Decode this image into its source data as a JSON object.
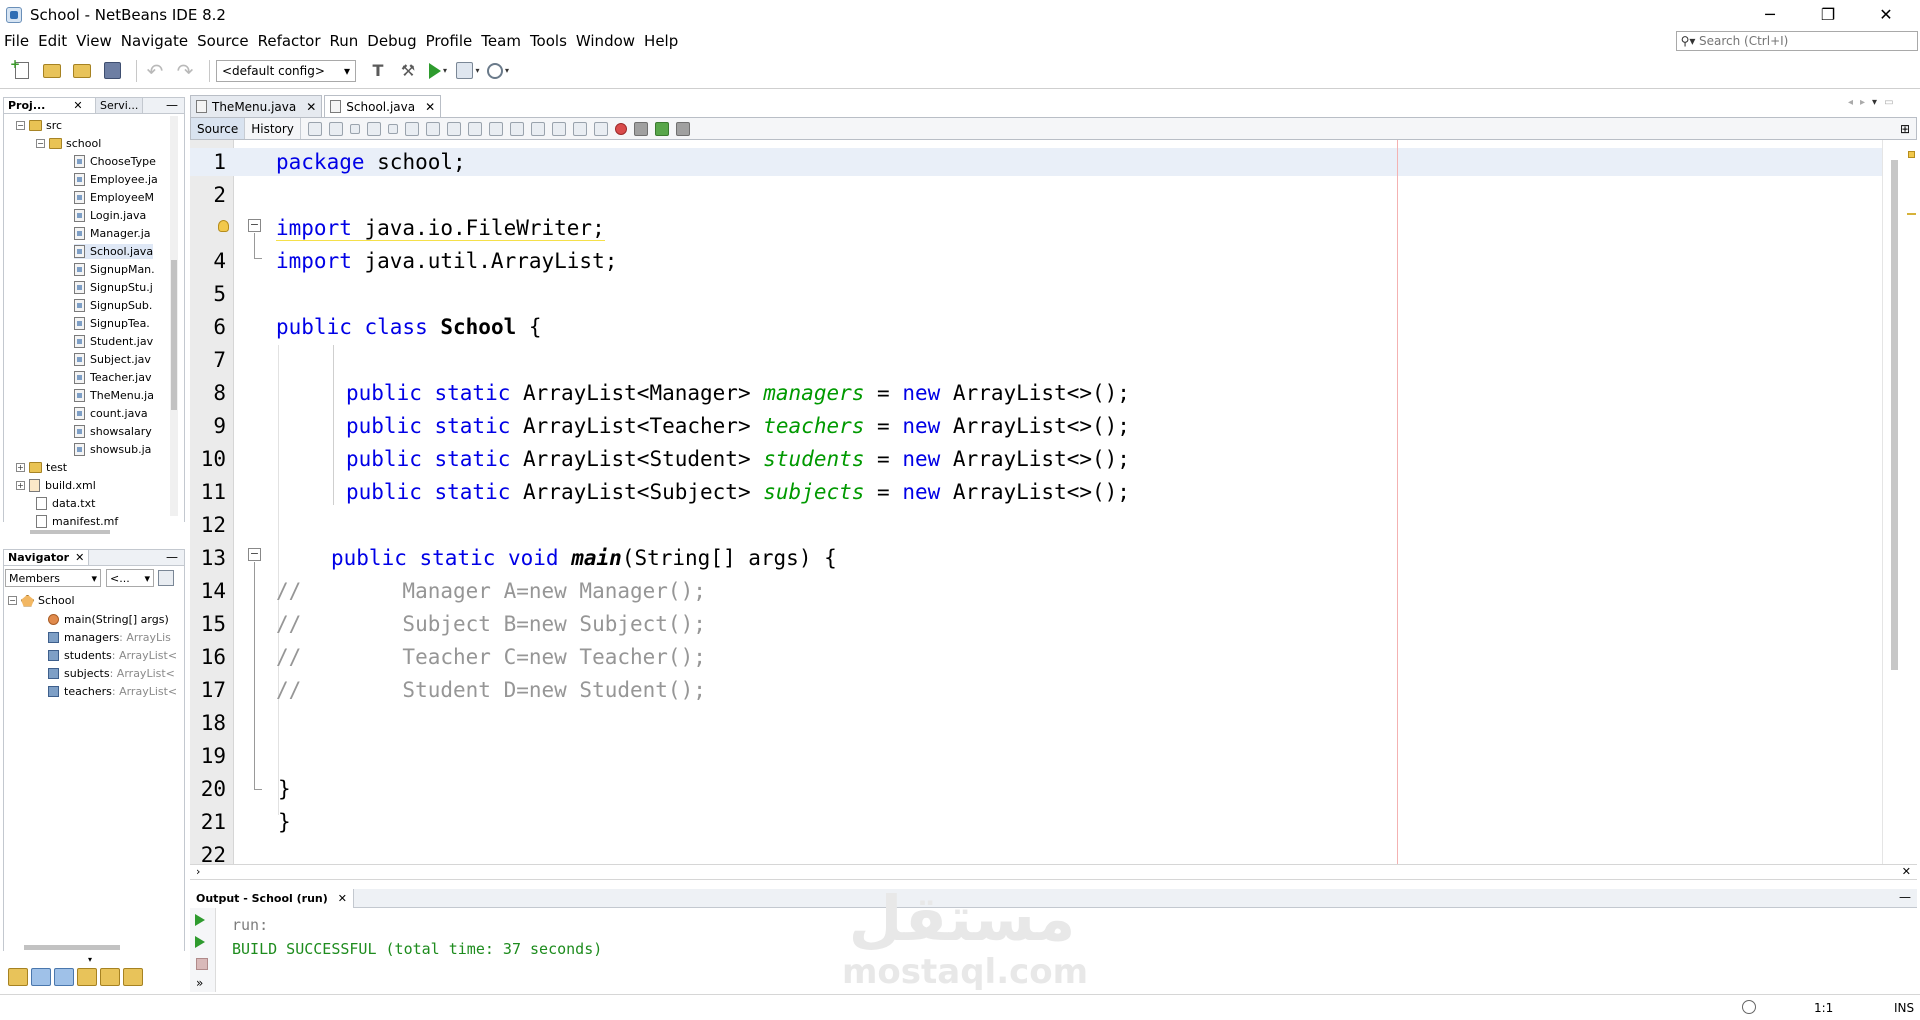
{
  "window": {
    "title": "School - NetBeans IDE 8.2",
    "minimize": "─",
    "maximize": "❐",
    "close": "✕"
  },
  "menu": [
    "File",
    "Edit",
    "View",
    "Navigate",
    "Source",
    "Refactor",
    "Run",
    "Debug",
    "Profile",
    "Team",
    "Tools",
    "Window",
    "Help"
  ],
  "search": {
    "placeholder": "Search (Ctrl+I)"
  },
  "toolbar": {
    "config": "<default config>"
  },
  "projects_panel": {
    "tabs": [
      "Proj...",
      "Servi..."
    ],
    "tree": [
      {
        "label": "src",
        "kind": "folder"
      },
      {
        "label": "school",
        "kind": "package"
      },
      {
        "label": "ChooseType",
        "kind": "java"
      },
      {
        "label": "Employee.ja",
        "kind": "java"
      },
      {
        "label": "EmployeeM",
        "kind": "java"
      },
      {
        "label": "Login.java",
        "kind": "java"
      },
      {
        "label": "Manager.ja",
        "kind": "java"
      },
      {
        "label": "School.java",
        "kind": "java"
      },
      {
        "label": "SignupMan.",
        "kind": "java"
      },
      {
        "label": "SignupStu.j",
        "kind": "java"
      },
      {
        "label": "SignupSub.",
        "kind": "java"
      },
      {
        "label": "SignupTea.",
        "kind": "java"
      },
      {
        "label": "Student.jav",
        "kind": "java"
      },
      {
        "label": "Subject.jav",
        "kind": "java"
      },
      {
        "label": "Teacher.jav",
        "kind": "java"
      },
      {
        "label": "TheMenu.ja",
        "kind": "java"
      },
      {
        "label": "count.java",
        "kind": "java"
      },
      {
        "label": "showsalary",
        "kind": "java"
      },
      {
        "label": "showsub.ja",
        "kind": "java"
      },
      {
        "label": "test",
        "kind": "folder"
      },
      {
        "label": "build.xml",
        "kind": "xml"
      },
      {
        "label": "data.txt",
        "kind": "txt"
      },
      {
        "label": "manifest.mf",
        "kind": "txt"
      }
    ]
  },
  "navigator": {
    "tab": "Navigator",
    "filter": "Members",
    "filter2": "<...",
    "root": "School",
    "members": [
      {
        "name": "main",
        "type": "(String[] args)",
        "kind": "method"
      },
      {
        "name": "managers",
        "type": " : ArrayLis",
        "kind": "field"
      },
      {
        "name": "students",
        "type": " : ArrayList<",
        "kind": "field"
      },
      {
        "name": "subjects",
        "type": " : ArrayList<",
        "kind": "field"
      },
      {
        "name": "teachers",
        "type": " : ArrayList<",
        "kind": "field"
      }
    ]
  },
  "editor": {
    "tabs": [
      "TheMenu.java",
      "School.java"
    ],
    "active_tab": "School.java",
    "view_tabs": [
      "Source",
      "History"
    ],
    "line_numbers": [
      "1",
      "2",
      "3",
      "4",
      "5",
      "6",
      "7",
      "8",
      "9",
      "10",
      "11",
      "12",
      "13",
      "14",
      "15",
      "16",
      "17",
      "18",
      "19",
      "20",
      "21",
      "22"
    ],
    "code": {
      "l1": {
        "kw": "package",
        "rest": " school;"
      },
      "l3": {
        "kw": "import",
        "rest": " java.io.FileWriter;"
      },
      "l4": {
        "kw": "import",
        "rest": " java.util.ArrayList;"
      },
      "l6": {
        "kw": "public class",
        "cls": "School",
        "rest": " {"
      },
      "l8": {
        "kw": "public static",
        "type": " ArrayList<Manager> ",
        "field": "managers",
        "eq": " = ",
        "new": "new",
        "tail": " ArrayList<>();"
      },
      "l9": {
        "kw": "public static",
        "type": " ArrayList<Teacher> ",
        "field": "teachers",
        "eq": " = ",
        "new": "new",
        "tail": " ArrayList<>();"
      },
      "l10": {
        "kw": "public static",
        "type": " ArrayList<Student> ",
        "field": "students",
        "eq": " = ",
        "new": "new",
        "tail": " ArrayList<>();"
      },
      "l11": {
        "kw": "public static",
        "type": " ArrayList<Subject> ",
        "field": "subjects",
        "eq": " = ",
        "new": "new",
        "tail": " ArrayList<>();"
      },
      "l13": {
        "kw": "public static void",
        "method": "main",
        "rest": "(String[] args) {"
      },
      "l14": "//        Manager A=new Manager();",
      "l15": "//        Subject B=new Subject();",
      "l16": "//        Teacher C=new Teacher();",
      "l17": "//        Student D=new Student();",
      "l20": "}",
      "l21": "}"
    }
  },
  "output": {
    "tab": "Output - School (run)",
    "lines": [
      "run:",
      "BUILD SUCCESSFUL (total time: 37 seconds)"
    ]
  },
  "watermark": {
    "arabic": "مستقل",
    "latin": "mostaql.com"
  },
  "status": {
    "position": "1:1",
    "mode": "INS"
  }
}
